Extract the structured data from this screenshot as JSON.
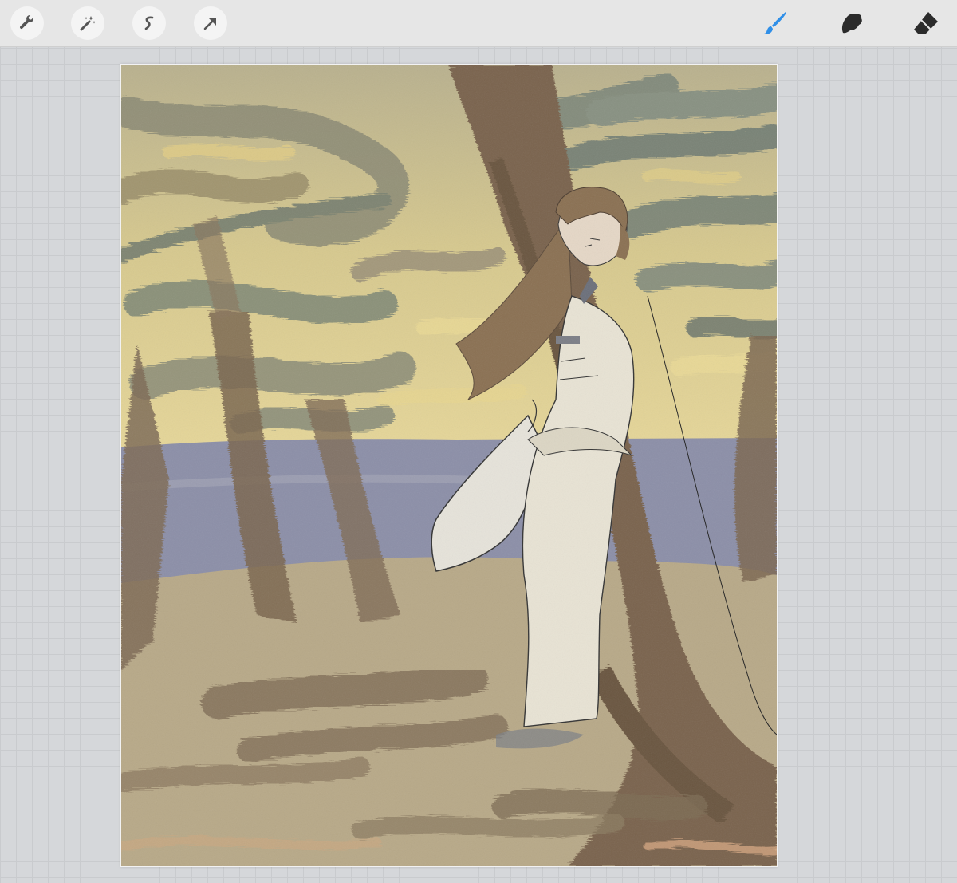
{
  "toolbar": {
    "left_tools": [
      {
        "name": "actions",
        "icon": "wrench-icon"
      },
      {
        "name": "adjustments",
        "icon": "magic-wand-icon"
      },
      {
        "name": "selection",
        "icon": "selection-s-icon"
      },
      {
        "name": "transform",
        "icon": "arrow-cursor-icon"
      }
    ],
    "right_tools": [
      {
        "name": "brush",
        "icon": "brush-icon",
        "active": true
      },
      {
        "name": "smudge",
        "icon": "smudge-icon",
        "active": false
      },
      {
        "name": "eraser",
        "icon": "eraser-icon",
        "active": false
      }
    ],
    "active_color": "#2f8fe8"
  },
  "canvas": {
    "content": "painting",
    "palette": {
      "ground": "#bcae8c",
      "trunk": "#7e6a52",
      "sea": "#8c8fa8",
      "sky": "#e6d79a",
      "foliage": "#7d8a80",
      "robe": "#e8e3d4",
      "hair": "#8a7052"
    }
  }
}
